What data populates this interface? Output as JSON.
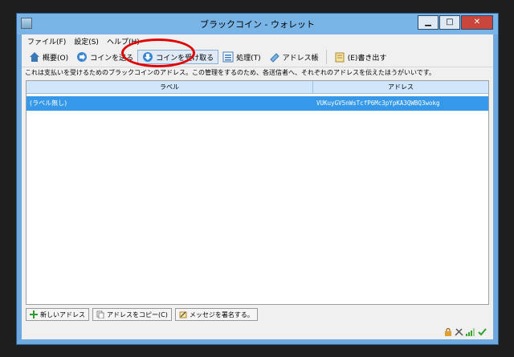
{
  "window": {
    "title": "ブラックコイン - ウォレット",
    "buttons": [
      "▁",
      "□",
      "✕"
    ]
  },
  "menu": [
    "ファイル(F)",
    "設定(S)",
    "ヘルプ(H)"
  ],
  "toolbar": [
    {
      "icon": "home-icon",
      "label": "概要(O)"
    },
    {
      "icon": "send-arrow-icon",
      "label": "コインを送る"
    },
    {
      "icon": "receive-arrow-icon",
      "label": "コインを受け取る",
      "active": true
    },
    {
      "icon": "transactions-list-icon",
      "label": "処理(T)"
    },
    {
      "icon": "address-book-icon",
      "label": "アドレス帳"
    },
    {
      "icon": "export-icon",
      "label": "(E)書き出す"
    }
  ],
  "description": "これは支払いを受けるためのブラックコインのアドレス。この管理をするのため、各送信者へ、それぞれのアドレスを伝えたほうがいいです。",
  "table": {
    "headers": [
      "ラベル",
      "アドレス"
    ],
    "rows": [
      {
        "label": "(ラベル無し)",
        "address": "VUKuyGV5nWsTcfP6Mc3pYpKA3QWBQ3wokg"
      }
    ]
  },
  "bottom_buttons": [
    {
      "icon": "new-address-icon",
      "label": "新しいアドレス"
    },
    {
      "icon": "copy-icon",
      "label": "アドレスをコピー(C)"
    },
    {
      "icon": "sign-message-icon",
      "label": "メッセジを署名する。"
    }
  ],
  "status_icons": [
    "lock-icon",
    "staking-icon",
    "signal-icon",
    "checkmark-icon"
  ],
  "colors": {
    "selection": "#3598e8",
    "header": "#cfe6fb",
    "annotation": "#e00000",
    "titlebar": "#78b4e6"
  }
}
